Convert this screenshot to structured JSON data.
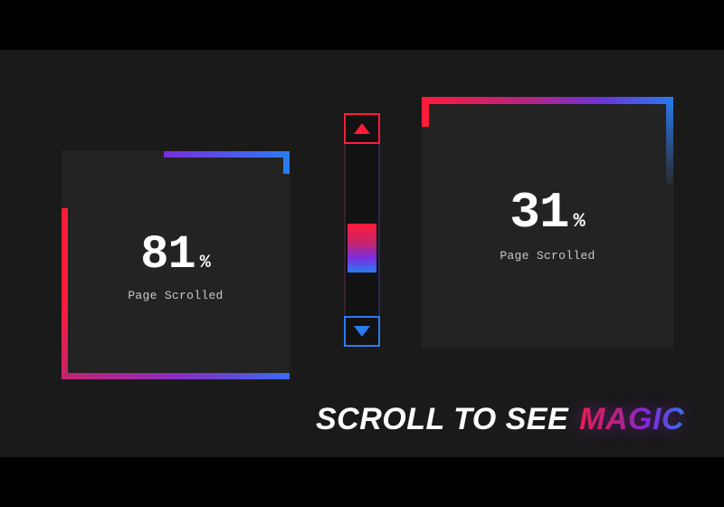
{
  "colors": {
    "bg_outer": "#000000",
    "bg_stage": "#1a1a1a",
    "card_bg": "#232323",
    "red": "#ff1b3a",
    "magenta": "#c5246d",
    "purple": "#7a2de0",
    "blue": "#2a7bf0",
    "text": "#ffffff",
    "muted": "#c9c9c9"
  },
  "left_card": {
    "percent": "81",
    "percent_sign": "%",
    "label": "Page Scrolled"
  },
  "right_card": {
    "percent": "31",
    "percent_sign": "%",
    "label": "Page Scrolled"
  },
  "scrollbar": {
    "up_icon": "triangle-up",
    "down_icon": "triangle-down",
    "thumb_position_pct": 46
  },
  "caption": {
    "prefix": "SCROLL TO SEE",
    "highlight": "MAGIC"
  }
}
